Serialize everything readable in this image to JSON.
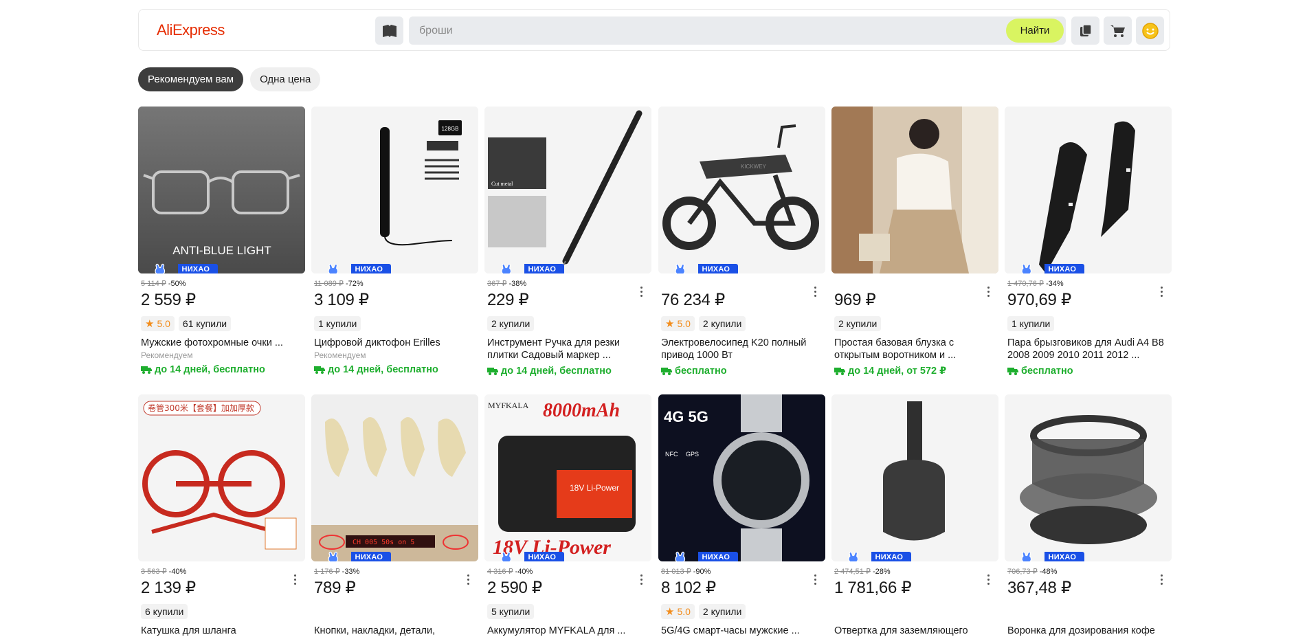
{
  "header": {
    "logo": "AliExpress",
    "search_placeholder": "броши",
    "search_button": "Найти"
  },
  "tabs": [
    {
      "label": "Рекомендуем вам",
      "active": true
    },
    {
      "label": "Одна цена",
      "active": false
    }
  ],
  "badge_label": "НИХАО СКИДКА",
  "products": [
    {
      "old_price": "5 114 ₽",
      "discount": "-50%",
      "price": "2 559 ₽",
      "rating": "5.0",
      "sold": "61 купили",
      "title": "Мужские фотохромные очки ...",
      "sub": "Рекомендуем",
      "shipping": "до 14 дней, бесплатно",
      "image_text": "ANTI-BLUE LIGHT"
    },
    {
      "old_price": "11 089 ₽",
      "discount": "-72%",
      "price": "3 109 ₽",
      "rating": "",
      "sold": "1 купили",
      "title": "Цифровой диктофон Erilles",
      "sub": "Рекомендуем",
      "shipping": "до 14 дней, бесплатно",
      "image_text": "128GB"
    },
    {
      "old_price": "367 ₽",
      "discount": "-38%",
      "price": "229 ₽",
      "rating": "",
      "sold": "2 купили",
      "title": "Инструмент Ручка для резки плитки Садовый маркер ...",
      "sub": "",
      "shipping": "до 14 дней, бесплатно",
      "image_text": "Cut metal"
    },
    {
      "old_price": "",
      "discount": "",
      "price": "76 234 ₽",
      "rating": "5.0",
      "sold": "2 купили",
      "title": "Электровелосипед K20 полный привод 1000 Вт",
      "sub": "",
      "shipping": "бесплатно",
      "image_text": "KICKWEY"
    },
    {
      "old_price": "",
      "discount": "",
      "price": "969 ₽",
      "rating": "",
      "sold": "2 купили",
      "title": "Простая базовая блузка с открытым воротником и ...",
      "sub": "",
      "shipping": "до 14 дней, от 572 ₽",
      "image_text": ""
    },
    {
      "old_price": "1 470,76 ₽",
      "discount": "-34%",
      "price": "970,69 ₽",
      "rating": "",
      "sold": "1 купили",
      "title": "Пара брызговиков для Audi A4 B8 2008 2009 2010 2011 2012 ...",
      "sub": "",
      "shipping": "бесплатно",
      "image_text": ""
    },
    {
      "old_price": "3 563 ₽",
      "discount": "-40%",
      "price": "2 139 ₽",
      "rating": "",
      "sold": "6 купили",
      "title": "Катушка для шланга",
      "sub": "",
      "shipping": "",
      "image_text": "卷管300米【套餐】加加厚款"
    },
    {
      "old_price": "1 176 ₽",
      "discount": "-33%",
      "price": "789 ₽",
      "rating": "",
      "sold": "",
      "title": "Кнопки, накладки, детали,",
      "sub": "",
      "shipping": "",
      "image_text": "CH 005 50s on 5"
    },
    {
      "old_price": "4 316 ₽",
      "discount": "-40%",
      "price": "2 590 ₽",
      "rating": "",
      "sold": "5 купили",
      "title": "Аккумулятор MYFKALA для ...",
      "sub": "",
      "shipping": "",
      "image_text": "8000mAh"
    },
    {
      "old_price": "81 013 ₽",
      "discount": "-90%",
      "price": "8 102 ₽",
      "rating": "5.0",
      "sold": "2 купили",
      "title": "5G/4G смарт-часы мужские ...",
      "sub": "",
      "shipping": "",
      "image_text": "4G 5G"
    },
    {
      "old_price": "2 474,51 ₽",
      "discount": "-28%",
      "price": "1 781,66 ₽",
      "rating": "",
      "sold": "",
      "title": "Отвертка для заземляющего",
      "sub": "",
      "shipping": "",
      "image_text": ""
    },
    {
      "old_price": "706,73 ₽",
      "discount": "-48%",
      "price": "367,48 ₽",
      "rating": "",
      "sold": "",
      "title": "Воронка для дозирования кофе",
      "sub": "",
      "shipping": "",
      "image_text": ""
    }
  ],
  "colors": {
    "brand": "#e62e04",
    "search_button": "#d9f461",
    "badge": "#1a50e6",
    "shipping": "#1eae2e",
    "rating": "#f28c1b"
  }
}
